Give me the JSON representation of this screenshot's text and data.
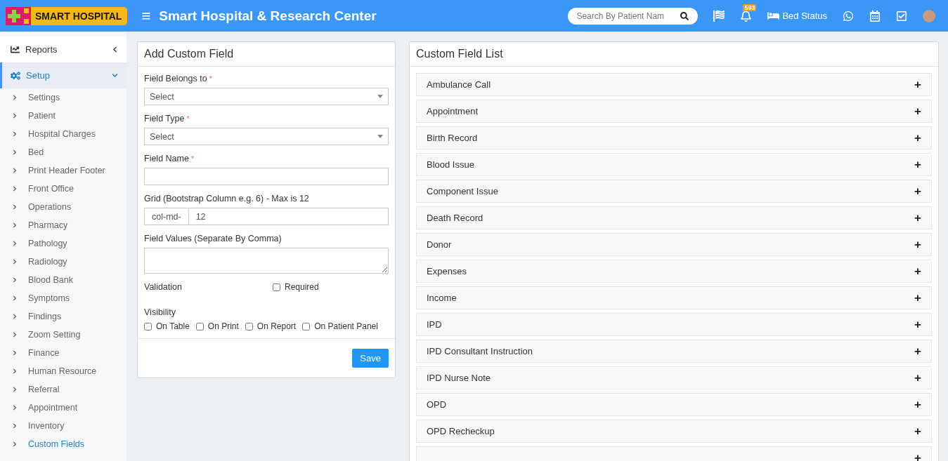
{
  "header": {
    "logo": "SMART HOSPITAL",
    "menu_glyph": "≡",
    "title": "Smart Hospital & Research Center",
    "search": {
      "placeholder": "Search By Patient Nam"
    },
    "notification_count": "593",
    "bed_status": "Bed Status"
  },
  "sidebar": {
    "items": [
      {
        "label": "Reports",
        "expanded": false,
        "selected": false,
        "kind": "reports"
      },
      {
        "label": "Setup",
        "expanded": true,
        "selected": true,
        "kind": "setup",
        "children": [
          {
            "label": "Settings",
            "selected": false
          },
          {
            "label": "Patient",
            "selected": false
          },
          {
            "label": "Hospital Charges",
            "selected": false
          },
          {
            "label": "Bed",
            "selected": false
          },
          {
            "label": "Print Header Footer",
            "selected": false
          },
          {
            "label": "Front Office",
            "selected": false
          },
          {
            "label": "Operations",
            "selected": false
          },
          {
            "label": "Pharmacy",
            "selected": false
          },
          {
            "label": "Pathology",
            "selected": false
          },
          {
            "label": "Radiology",
            "selected": false
          },
          {
            "label": "Blood Bank",
            "selected": false
          },
          {
            "label": "Symptoms",
            "selected": false
          },
          {
            "label": "Findings",
            "selected": false
          },
          {
            "label": "Zoom Setting",
            "selected": false
          },
          {
            "label": "Finance",
            "selected": false
          },
          {
            "label": "Human Resource",
            "selected": false
          },
          {
            "label": "Referral",
            "selected": false
          },
          {
            "label": "Appointment",
            "selected": false
          },
          {
            "label": "Inventory",
            "selected": false
          },
          {
            "label": "Custom Fields",
            "selected": true
          }
        ]
      }
    ]
  },
  "add_form": {
    "title": "Add Custom Field",
    "required_mark": "*",
    "fields": [
      {
        "kind": "select",
        "label": "Field Belongs to",
        "required": true,
        "value": "Select"
      },
      {
        "kind": "select",
        "label": "Field Type",
        "required": true,
        "value": "Select"
      },
      {
        "kind": "text",
        "label": "Field Name",
        "required": true
      },
      {
        "kind": "addon",
        "label": "Grid (Bootstrap Column e.g. 6) - Max is 12",
        "required": false,
        "addon": "col-md-",
        "value": "12"
      },
      {
        "kind": "textarea",
        "label": "Field Values (Separate By Comma)",
        "required": false
      }
    ],
    "validation": {
      "label": "Validation",
      "option": {
        "label": "Required",
        "checked": false
      }
    },
    "visibility": {
      "label": "Visibility",
      "options": [
        {
          "label": "On Table",
          "checked": false
        },
        {
          "label": "On Print",
          "checked": false
        },
        {
          "label": "On Report",
          "checked": false
        },
        {
          "label": "On Patient Panel",
          "checked": false
        }
      ]
    },
    "save_button": "Save"
  },
  "list": {
    "title": "Custom Field List",
    "expand_glyph": "+",
    "items": [
      {
        "kind": "field",
        "label": "Ambulance Call"
      },
      {
        "kind": "field",
        "label": "Appointment"
      },
      {
        "kind": "field",
        "label": "Birth Record"
      },
      {
        "kind": "field",
        "label": "Blood Issue"
      },
      {
        "kind": "field",
        "label": "Component Issue"
      },
      {
        "kind": "field",
        "label": "Death Record"
      },
      {
        "kind": "field",
        "label": "Donor"
      },
      {
        "kind": "field",
        "label": "Expenses"
      },
      {
        "kind": "field",
        "label": "Income"
      },
      {
        "kind": "field",
        "label": "IPD"
      },
      {
        "kind": "field",
        "label": "IPD Consultant Instruction"
      },
      {
        "kind": "field",
        "label": "IPD Nurse Note"
      },
      {
        "kind": "field",
        "label": "OPD"
      },
      {
        "kind": "field",
        "label": "OPD Recheckup"
      },
      {
        "kind": "blank"
      }
    ]
  }
}
